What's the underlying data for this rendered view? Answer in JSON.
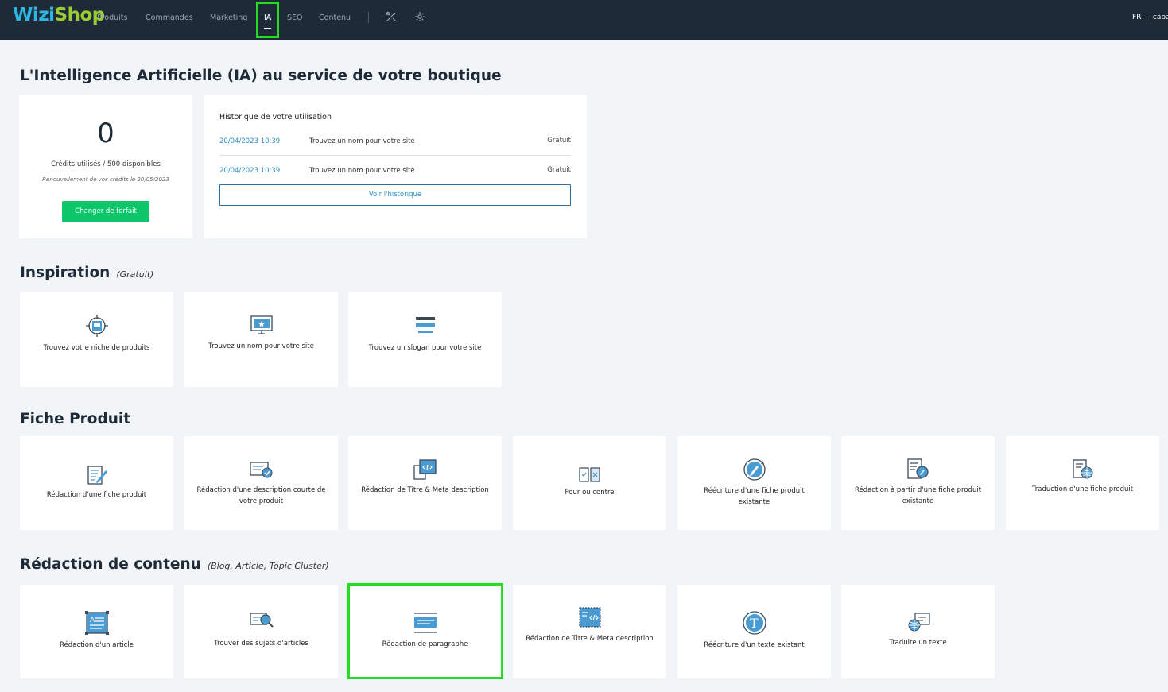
{
  "header": {
    "logo_part1": "Wizi",
    "logo_part2": "Shop",
    "nav": [
      "Produits",
      "Commandes",
      "Marketing",
      "IA",
      "SEO",
      "Contenu"
    ],
    "active_nav": "IA",
    "lang": "FR",
    "user": "caba"
  },
  "page_title": "L'Intelligence Artificielle (IA) au service de votre boutique",
  "credits": {
    "used": "0",
    "text": "Crédits utilisés / 500 disponibles",
    "renewal": "Renouvellement de vos crédits le 20/05/2023",
    "button": "Changer de forfait"
  },
  "history": {
    "title": "Historique de votre utilisation",
    "rows": [
      {
        "date": "20/04/2023 10:39",
        "label": "Trouvez un nom pour votre site",
        "price": "Gratuit"
      },
      {
        "date": "20/04/2023 10:39",
        "label": "Trouvez un nom pour votre site",
        "price": "Gratuit"
      }
    ],
    "button": "Voir l'historique"
  },
  "sections": [
    {
      "title": "Inspiration",
      "subtitle": "(Gratuit)",
      "tiles": [
        {
          "label": "Trouvez votre niche de produits",
          "icon": "target-icon"
        },
        {
          "label": "Trouvez un nom pour votre site",
          "icon": "monitor-icon"
        },
        {
          "label": "Trouvez un slogan pour votre site",
          "icon": "slogan-icon"
        }
      ]
    },
    {
      "title": "Fiche Produit",
      "subtitle": "",
      "tiles": [
        {
          "label": "Rédaction d'une fiche produit",
          "icon": "edit-document-icon"
        },
        {
          "label": "Rédaction d'une description courte de votre produit",
          "icon": "screen-check-icon"
        },
        {
          "label": "Rédaction de Titre & Meta description",
          "icon": "code-window-icon"
        },
        {
          "label": "Pour ou contre",
          "icon": "pros-cons-icon"
        },
        {
          "label": "Réécriture d'une fiche produit existante",
          "icon": "rewrite-icon"
        },
        {
          "label": "Rédaction à partir d'une fiche produit existante",
          "icon": "document-search-icon"
        },
        {
          "label": "Traduction d'une fiche produit",
          "icon": "translate-document-icon"
        }
      ]
    },
    {
      "title": "Rédaction de contenu",
      "subtitle": "(Blog, Article, Topic Cluster)",
      "tiles": [
        {
          "label": "Rédaction d'un article",
          "icon": "article-icon"
        },
        {
          "label": "Trouver des sujets d'articles",
          "icon": "topic-search-icon"
        },
        {
          "label": "Rédaction de paragraphe",
          "icon": "paragraph-icon"
        },
        {
          "label": "Rédaction de Titre & Meta description",
          "icon": "meta-code-icon"
        },
        {
          "label": "Réécriture d'un texte existant",
          "icon": "text-rewrite-icon"
        },
        {
          "label": "Traduire un texte",
          "icon": "translate-text-icon"
        }
      ]
    }
  ],
  "colors": {
    "header_bg": "#1e2a38",
    "accent_green": "#0cc66a",
    "link_blue": "#2e8fc2",
    "icon_blue": "#4a9bd1",
    "highlight": "#22dd22"
  }
}
